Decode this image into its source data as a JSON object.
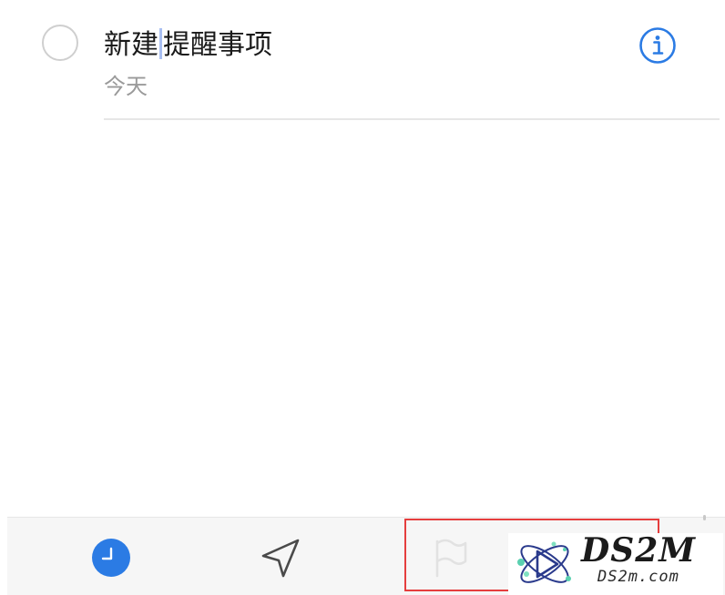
{
  "reminder": {
    "title_before_caret": "新建",
    "title_after_caret": "提醒事项",
    "date": "今天"
  },
  "icons": {
    "complete": "circle-icon",
    "info": "info-icon",
    "time": "clock-icon",
    "location": "location-arrow-icon",
    "flag": "flag-icon"
  },
  "colors": {
    "accent_blue": "#2b7be4",
    "highlight_red": "#e53e3e",
    "flag_disabled": "#e2e2e2"
  },
  "watermark": {
    "brand": "DS2M",
    "domain": "DS2m.com"
  }
}
